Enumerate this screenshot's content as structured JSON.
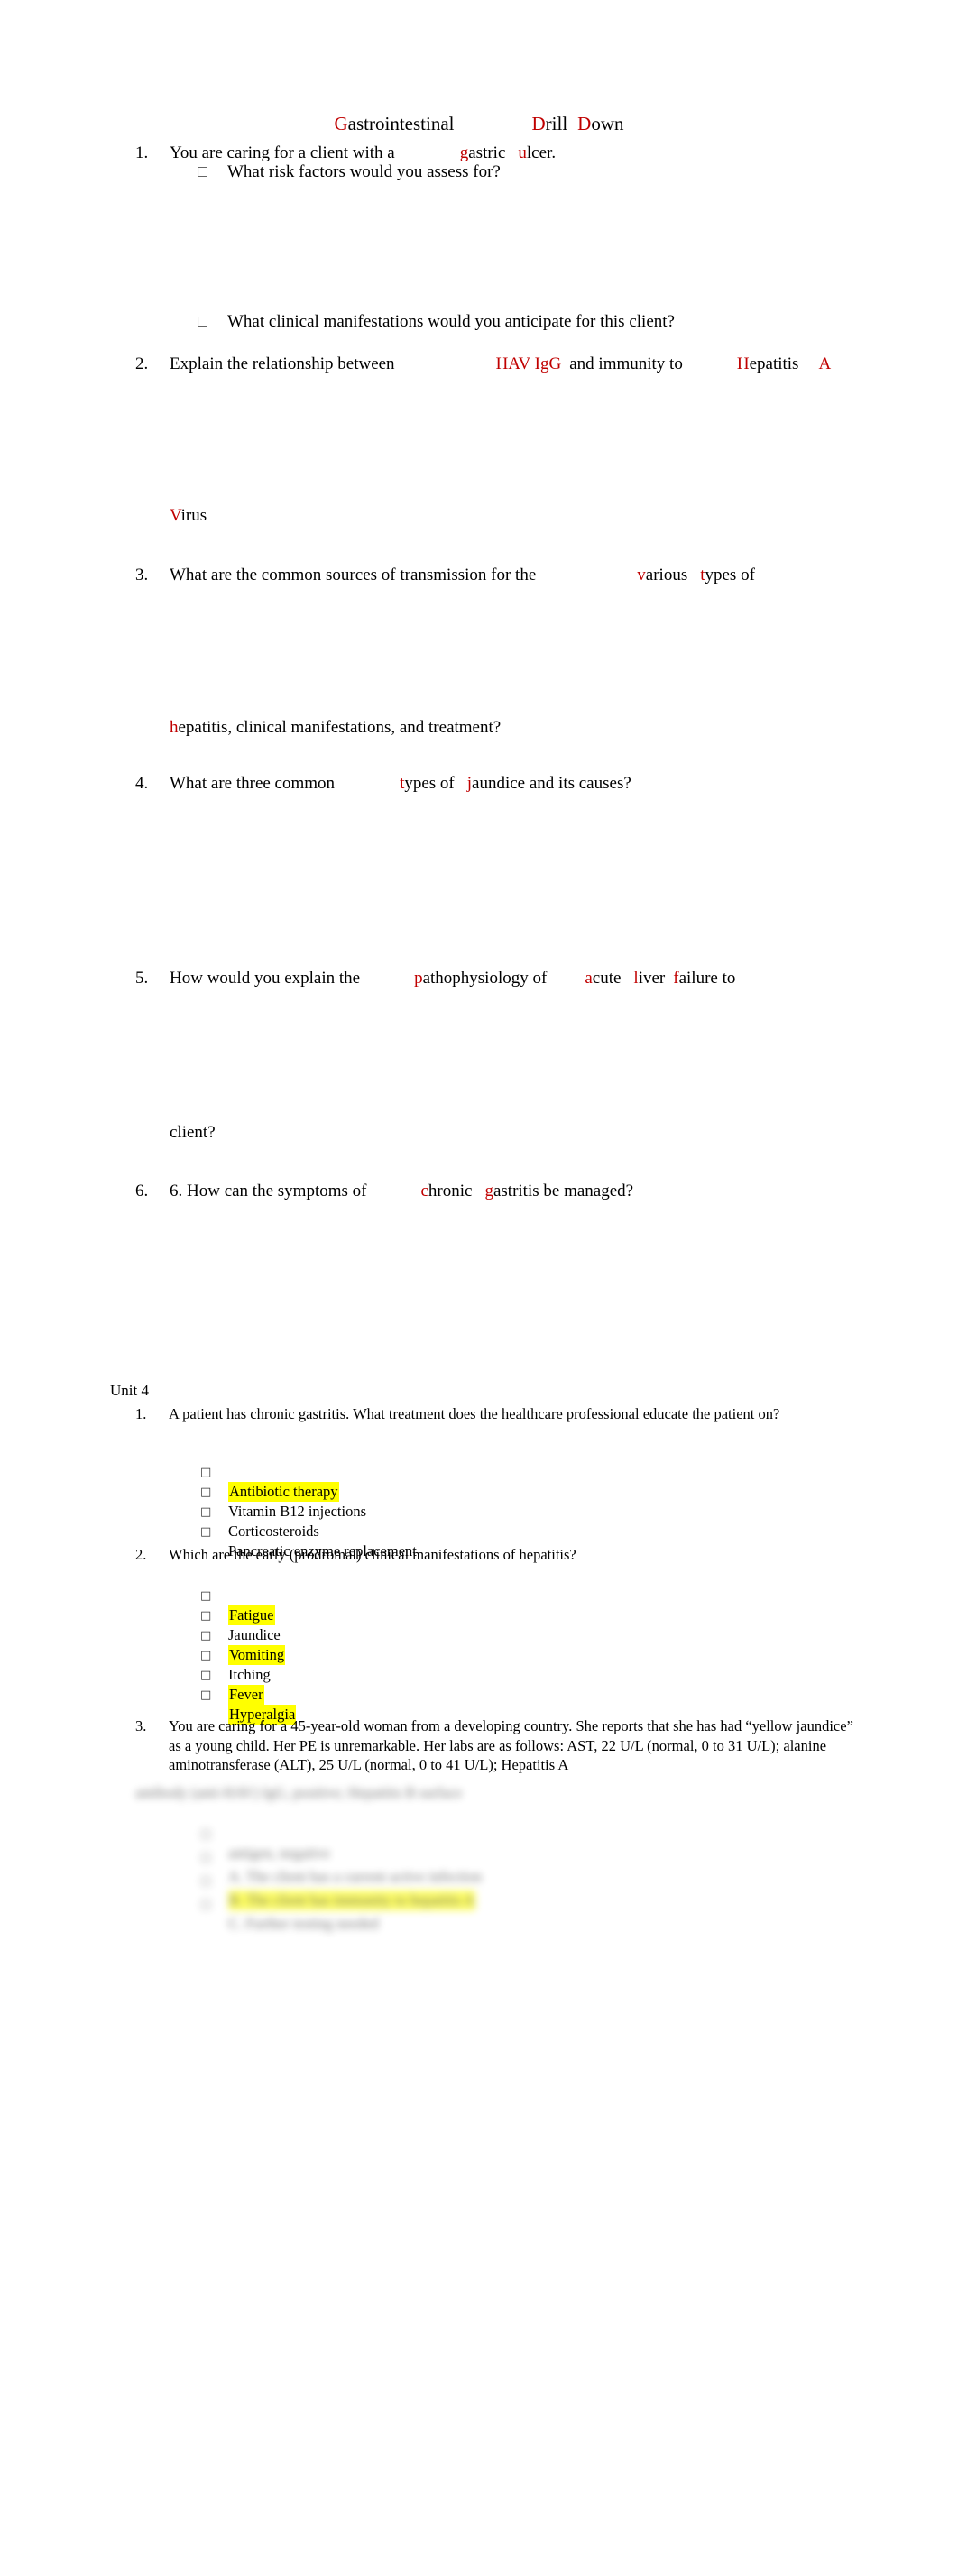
{
  "document": {
    "colors": {
      "accent_red": "#C00000",
      "highlight_yellow": "#FFFF00",
      "text": "#000000",
      "page_background": "#FFFFFF"
    },
    "title": {
      "part1_initial": "G",
      "part1_rest": "astrointestinal",
      "part2_initial": "D",
      "part2_rest": "rill",
      "part3_initial": "D",
      "part3_rest": "own",
      "full_text": "Gastrointestinal Drill Down"
    },
    "section1": {
      "questions": [
        {
          "number": "1.",
          "segments": [
            {
              "text": "You are caring for a client with a",
              "color": "black"
            },
            {
              "gap": "gap-a"
            },
            {
              "text": "g",
              "color": "red"
            },
            {
              "text": "astric",
              "color": "black"
            },
            {
              "gap": "gap-c"
            },
            {
              "text": "u",
              "color": "red"
            },
            {
              "text": "lcer.",
              "color": "black"
            }
          ],
          "plain": "You are caring for a client with a gastric ulcer.",
          "sub_items": [
            {
              "bullet": "box-bullet-glyph",
              "text": "What risk factors would you assess for?"
            },
            {
              "bullet": "box-bullet-glyph",
              "text": "What clinical manifestations would you anticipate for this client?"
            }
          ]
        },
        {
          "number": "2.",
          "plain": "Explain the relationship between HAV IgG and immunity to Hepatitis A Virus",
          "line1_lead": "Explain the relationship between",
          "line1_red1": "HAV IgG",
          "line1_mid": "and immunity to",
          "line1_red2_initial": "H",
          "line1_red2_rest": "epatitis",
          "line1_red3": "A",
          "line2_initial": "V",
          "line2_rest": "irus"
        },
        {
          "number": "3.",
          "plain": "What are the common sources of transmission for the various types of hepatitis, clinical manifestations, and treatment?",
          "line1_lead": "What are the common sources of transmission for the",
          "line1_red1_initial": "v",
          "line1_red1_rest": "arious",
          "line1_red2_initial": "t",
          "line1_red2_rest": "ypes of",
          "line2_initial": "h",
          "line2_rest": "epatitis, clinical manifestations, and treatment?"
        },
        {
          "number": "4.",
          "plain": "What are three common types of jaundice and its causes?",
          "lead": "What are three common",
          "red1_initial": "t",
          "red1_rest": "ypes of",
          "red2_initial": "j",
          "red2_rest": "aundice and its causes?"
        },
        {
          "number": "5.",
          "plain": "How would you explain the pathophysiology of acute liver failure to client?",
          "line1_lead": "How would you explain the",
          "red1_initial": "p",
          "red1_rest": "athophysiology of",
          "red2_initial": "a",
          "red2_rest": "cute",
          "red3_initial": "l",
          "red3_rest": "iver",
          "red4_initial": "f",
          "red4_rest": "ailure to",
          "line2": "client?"
        },
        {
          "number": "6.",
          "plain": "6. How can the symptoms of chronic gastritis be managed?",
          "lead": "6. How can the symptoms of",
          "red1_initial": "c",
          "red1_rest": "hronic",
          "red2_initial": "g",
          "red2_rest": "astritis be managed?"
        }
      ]
    },
    "section2": {
      "heading": "Unit 4",
      "questions": [
        {
          "number": "1.",
          "stem": "A patient has chronic gastritis. What treatment does the healthcare professional educate the patient on?",
          "options": [
            {
              "text": "Antibiotic therapy",
              "highlighted": true
            },
            {
              "text": "Vitamin B12 injections",
              "highlighted": false
            },
            {
              "text": "Corticosteroids",
              "highlighted": false
            },
            {
              "text": "Pancreatic enzyme replacement",
              "highlighted": false
            }
          ]
        },
        {
          "number": "2.",
          "stem": "Which are the early (prodromal) clinical manifestations of hepatitis?",
          "options": [
            {
              "text": "Fatigue",
              "highlighted": true
            },
            {
              "text": "Jaundice",
              "highlighted": false
            },
            {
              "text": "Vomiting",
              "highlighted": true
            },
            {
              "text": "Itching",
              "highlighted": false
            },
            {
              "text": "Fever",
              "highlighted": true
            },
            {
              "text": "Hyperalgia",
              "highlighted": true
            }
          ]
        },
        {
          "number": "3.",
          "stem": "You are caring for a 45-year-old woman from a developing country. She reports that she has had “yellow jaundice” as a young child. Her PE is unremarkable. Her labs are as follows: AST, 22 U/L (normal, 0 to 31 U/L); alanine aminotransferase (ALT), 25 U/L (normal, 0 to 41 U/L); Hepatitis A",
          "obscured_note": "remaining text and answer options are blurred and illegible",
          "blurred_lines": [
            "antibody (anti-HAV) IgG, positive; Hepatitis B surface",
            "antigen, negative",
            "A. The client has a current active infection",
            "B. The client has immunity to hepatitis A",
            "C. Further testing needed"
          ]
        }
      ]
    }
  }
}
